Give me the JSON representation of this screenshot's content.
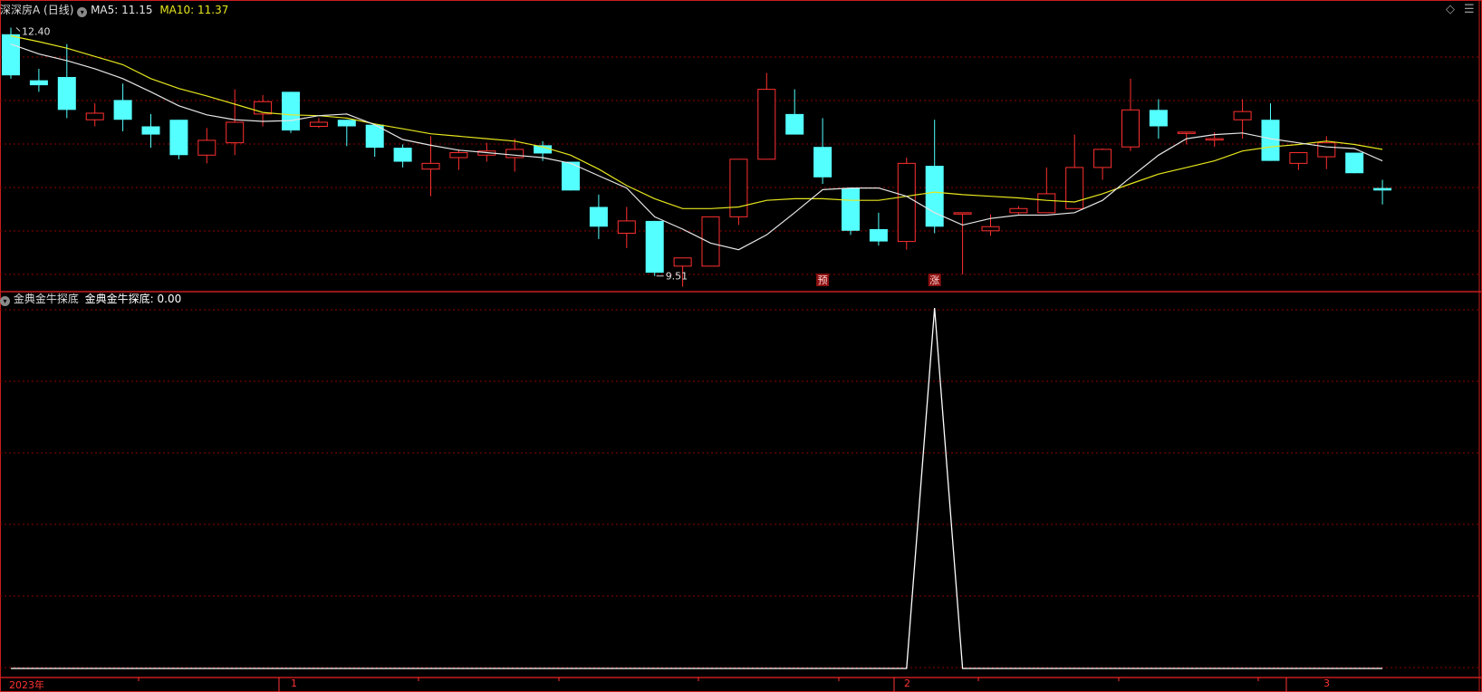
{
  "main_panel": {
    "stock_name": "深深房A",
    "period": "(日线)",
    "ma5_label": "MA5: 11.15",
    "ma10_label": "MA10: 11.37",
    "high_label": "12.40",
    "low_label": "9.51",
    "marker_1": "预",
    "marker_2": "涨",
    "colors": {
      "up": "#ff3030",
      "down": "#54ffff",
      "ma5": "#e6e6e6",
      "ma10": "#e6e61e",
      "grid": "#8b0000",
      "border": "#c81e1e"
    }
  },
  "sub_panel": {
    "indicator_name": "金典金牛探底",
    "value_label": "金典金牛探底: 0.00"
  },
  "time_axis": {
    "labels": [
      "2023年",
      "1",
      "2",
      "3"
    ]
  },
  "icons": [
    "diamond-icon",
    "menu-icon",
    "collapse-icon"
  ],
  "chart_data": [
    {
      "type": "candlestick",
      "title": "深深房A (日线)",
      "ylim": [
        9.4,
        12.55
      ],
      "series": [
        {
          "name": "K",
          "ohlc": [
            [
              12.42,
              12.5,
              11.88,
              11.92
            ],
            [
              11.86,
              12.0,
              11.72,
              11.8
            ],
            [
              11.9,
              12.3,
              11.4,
              11.5
            ],
            [
              11.38,
              11.58,
              11.3,
              11.46
            ],
            [
              11.62,
              11.82,
              11.24,
              11.38
            ],
            [
              11.3,
              11.45,
              11.04,
              11.2
            ],
            [
              11.38,
              11.38,
              10.9,
              10.95
            ],
            [
              10.95,
              11.28,
              10.85,
              11.13
            ],
            [
              11.1,
              11.75,
              10.95,
              11.35
            ],
            [
              11.45,
              11.68,
              11.3,
              11.6
            ],
            [
              11.72,
              11.72,
              11.22,
              11.25
            ],
            [
              11.3,
              11.4,
              11.28,
              11.35
            ],
            [
              11.38,
              11.38,
              11.06,
              11.3
            ],
            [
              11.32,
              11.32,
              10.93,
              11.04
            ],
            [
              11.04,
              11.08,
              10.8,
              10.87
            ],
            [
              10.78,
              11.18,
              10.45,
              10.85
            ],
            [
              10.92,
              11.02,
              10.77,
              10.98
            ],
            [
              10.95,
              11.1,
              10.87,
              11.0
            ],
            [
              10.92,
              11.15,
              10.75,
              11.02
            ],
            [
              11.07,
              11.12,
              10.88,
              10.97
            ],
            [
              10.87,
              10.87,
              10.52,
              10.52
            ],
            [
              10.32,
              10.47,
              9.93,
              10.08
            ],
            [
              10.0,
              10.32,
              9.82,
              10.15
            ],
            [
              10.15,
              10.15,
              9.48,
              9.52
            ],
            [
              9.6,
              9.7,
              9.35,
              9.7
            ],
            [
              9.6,
              10.2,
              9.6,
              10.2
            ],
            [
              10.2,
              10.9,
              10.1,
              10.9
            ],
            [
              10.9,
              11.95,
              10.9,
              11.75
            ],
            [
              11.45,
              11.75,
              11.2,
              11.2
            ],
            [
              11.05,
              11.4,
              10.6,
              10.68
            ],
            [
              10.55,
              10.55,
              9.98,
              10.03
            ],
            [
              10.05,
              10.25,
              9.85,
              9.9
            ],
            [
              9.9,
              10.92,
              9.8,
              10.85
            ],
            [
              10.82,
              11.38,
              10.0,
              10.08
            ],
            [
              10.25,
              10.25,
              9.5,
              10.25
            ],
            [
              10.03,
              10.23,
              9.97,
              10.08
            ],
            [
              10.25,
              10.33,
              10.23,
              10.3
            ],
            [
              10.25,
              10.8,
              10.25,
              10.48
            ],
            [
              10.3,
              11.2,
              10.3,
              10.8
            ],
            [
              10.8,
              11.03,
              10.65,
              11.02
            ],
            [
              11.05,
              11.88,
              11.0,
              11.5
            ],
            [
              11.5,
              11.63,
              11.15,
              11.3
            ],
            [
              11.23,
              11.23,
              11.08,
              11.23
            ],
            [
              11.15,
              11.23,
              11.05,
              11.15
            ],
            [
              11.38,
              11.63,
              11.15,
              11.48
            ],
            [
              11.38,
              11.58,
              10.88,
              10.88
            ],
            [
              10.85,
              10.98,
              10.77,
              10.98
            ],
            [
              10.93,
              11.18,
              10.78,
              11.1
            ],
            [
              10.98,
              10.98,
              10.73,
              10.73
            ],
            [
              10.55,
              10.65,
              10.35,
              10.52
            ]
          ]
        },
        {
          "name": "MA5",
          "values": [
            12.3,
            12.18,
            12.1,
            12.0,
            11.88,
            11.72,
            11.55,
            11.44,
            11.38,
            11.36,
            11.37,
            11.43,
            11.45,
            11.32,
            11.14,
            11.07,
            11.01,
            10.98,
            10.95,
            10.92,
            10.85,
            10.7,
            10.55,
            10.2,
            10.05,
            9.88,
            9.8,
            9.98,
            10.25,
            10.53,
            10.55,
            10.55,
            10.45,
            10.25,
            10.1,
            10.18,
            10.22,
            10.22,
            10.25,
            10.4,
            10.68,
            10.95,
            11.15,
            11.2,
            11.22,
            11.15,
            11.1,
            11.05,
            11.03,
            10.88
          ]
        },
        {
          "name": "MA10",
          "values": [
            12.4,
            12.33,
            12.25,
            12.15,
            12.05,
            11.88,
            11.76,
            11.67,
            11.57,
            11.47,
            11.44,
            11.43,
            11.4,
            11.33,
            11.27,
            11.21,
            11.18,
            11.15,
            11.12,
            11.05,
            10.95,
            10.78,
            10.58,
            10.42,
            10.3,
            10.3,
            10.32,
            10.4,
            10.42,
            10.42,
            10.4,
            10.4,
            10.45,
            10.5,
            10.47,
            10.45,
            10.43,
            10.4,
            10.38,
            10.48,
            10.6,
            10.72,
            10.8,
            10.88,
            11.0,
            11.05,
            11.08,
            11.12,
            11.08,
            11.02
          ]
        }
      ]
    },
    {
      "type": "line",
      "title": "金典金牛探底",
      "ylim": [
        0,
        1
      ],
      "series": [
        {
          "name": "金典金牛探底",
          "values": [
            0,
            0,
            0,
            0,
            0,
            0,
            0,
            0,
            0,
            0,
            0,
            0,
            0,
            0,
            0,
            0,
            0,
            0,
            0,
            0,
            0,
            0,
            0,
            0,
            0,
            0,
            0,
            0,
            0,
            0,
            0,
            0,
            0,
            1,
            0,
            0,
            0,
            0,
            0,
            0,
            0,
            0,
            0,
            0,
            0,
            0,
            0,
            0,
            0,
            0
          ]
        }
      ]
    }
  ]
}
